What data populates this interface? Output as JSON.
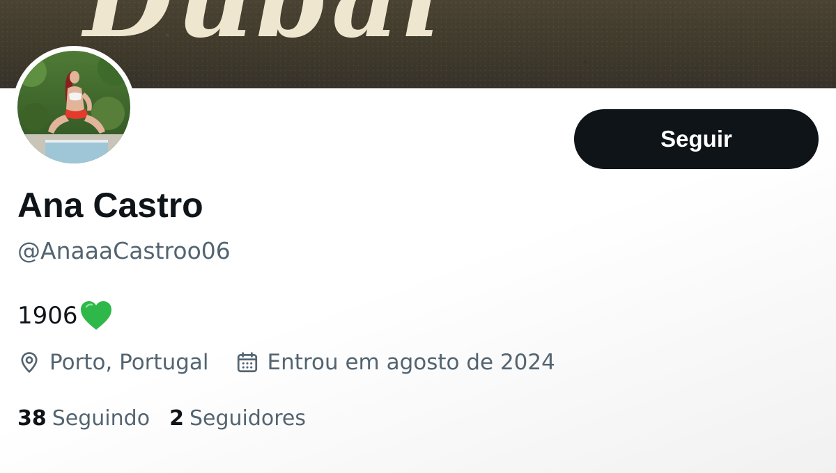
{
  "banner": {
    "text": "Dubai"
  },
  "profile": {
    "name": "Ana Castro",
    "handle": "@AnaaaCastroo06",
    "bio_text": "1906",
    "bio_emoji_icon": "green-heart-icon",
    "location": "Porto, Portugal",
    "location_icon": "location-pin-icon",
    "joined": "Entrou em agosto de 2024",
    "joined_icon": "calendar-icon"
  },
  "actions": {
    "follow_label": "Seguir"
  },
  "stats": {
    "following_count": "38",
    "following_label": "Seguindo",
    "followers_count": "2",
    "followers_label": "Seguidores"
  },
  "colors": {
    "primary_text": "#0f1419",
    "secondary_text": "#536471",
    "button_bg": "#0f1419",
    "heart": "#2fb84a"
  }
}
